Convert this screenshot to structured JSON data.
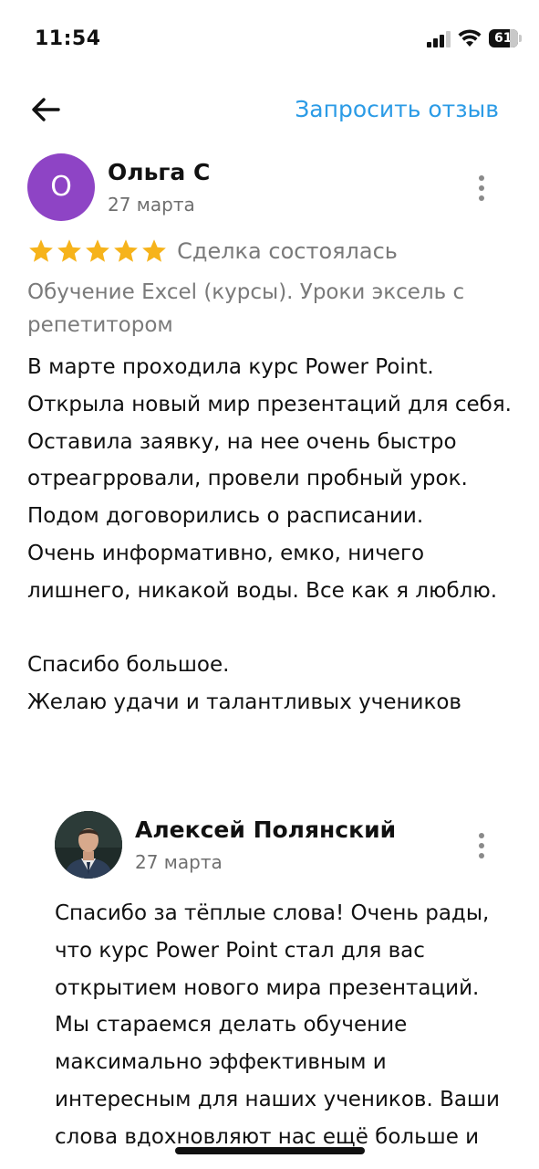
{
  "status_bar": {
    "time": "11:54",
    "battery": "61"
  },
  "app_bar": {
    "back_icon": "arrow-left-icon",
    "request_review_label": "Запросить отзыв",
    "accent_color": "#2b9be6"
  },
  "review": {
    "avatar_letter": "О",
    "avatar_color": "#8e44c5",
    "author": "Ольга С",
    "date": "27 марта",
    "rating": 5,
    "rating_max": 5,
    "star_color": "#f6b31b",
    "deal_status": "Сделка состоялась",
    "service": "Обучение Excel (курсы). Уроки эксель с репетитором",
    "text": "В марте проходила курс Power Point.\nОткрыла новый мир презентаций для себя.\nОставила заявку, на нее очень быстро отреагрровали, провели пробный урок.\nПодом договорились о расписании.\nОчень информативно, емко, ничего лишнего, никакой воды. Все как я люблю.\n\nСпасибо большое.\nЖелаю удачи и талантливых учеников"
  },
  "reply": {
    "author": "Алексей Полянский",
    "date": "27 марта",
    "text": "Спасибо за тёплые слова! Очень рады, что курс Power Point стал для вас открытием нового мира презентаций. Мы стараемся делать обучение максимально эффективным и интересным для наших учеников. Ваши слова вдохновляют нас ещё больше и"
  }
}
